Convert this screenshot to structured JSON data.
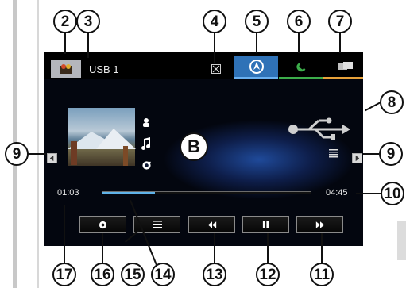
{
  "topbar": {
    "source_label": "USB 1",
    "source_icon": "media-source-icon",
    "status_icon": "no-signal-icon",
    "buttons": [
      {
        "name": "navigation",
        "icon": "navigation-icon",
        "accent": "#2f72b7"
      },
      {
        "name": "phone",
        "icon": "phone-icon",
        "accent": "#3cad4a"
      },
      {
        "name": "media",
        "icon": "media-icon",
        "accent": "#e8a23a"
      }
    ]
  },
  "track": {
    "art_icon": "album-art",
    "artist_icon": "person-icon",
    "album_icon": "music-note-icon",
    "repeat_icon": "repeat-icon",
    "source_type_icon": "usb-icon",
    "list_icon": "list-icon"
  },
  "player": {
    "elapsed": "01:03",
    "total": "04:45",
    "progress_fraction": 0.25,
    "controls": [
      {
        "name": "options",
        "icon": "options-icon",
        "glyph": "⚙"
      },
      {
        "name": "list",
        "icon": "list-icon",
        "glyph": "☰"
      },
      {
        "name": "previous",
        "icon": "rewind-icon",
        "glyph": "◀◀"
      },
      {
        "name": "pause",
        "icon": "pause-icon",
        "glyph": "❚❚"
      },
      {
        "name": "next",
        "icon": "fast-forward-icon",
        "glyph": "▶▶"
      }
    ]
  },
  "annotations": {
    "screen_label": "B",
    "callouts": [
      "2",
      "3",
      "4",
      "5",
      "6",
      "7",
      "8",
      "9",
      "9",
      "10",
      "11",
      "12",
      "13",
      "14",
      "15",
      "16",
      "17"
    ]
  },
  "colors": {
    "screen_bg": "#03060f",
    "glow": "#1f4a9a",
    "progress": "#5fb2e8"
  }
}
